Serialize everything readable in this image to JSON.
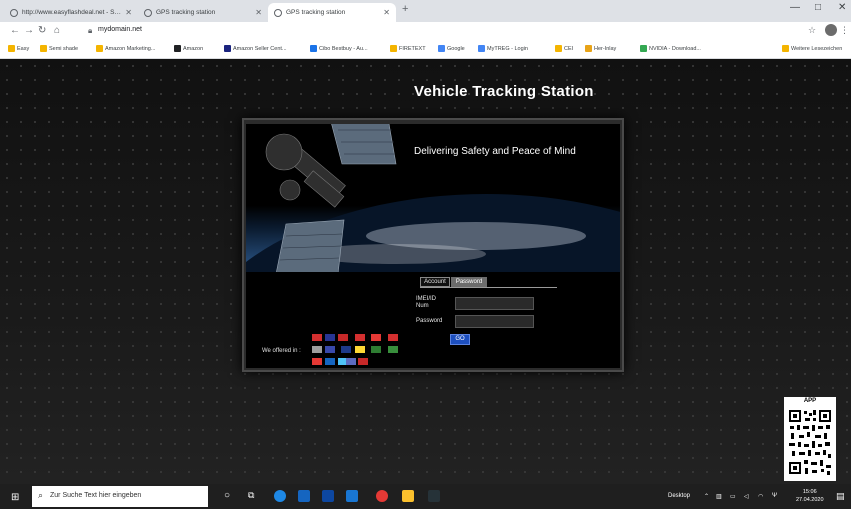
{
  "browser": {
    "tabs": [
      {
        "title": "http://www.easyflashdeal.net - Sicurp",
        "active": false
      },
      {
        "title": "GPS tracking station",
        "active": false
      },
      {
        "title": "GPS tracking station",
        "active": true
      }
    ],
    "url": "mydomain.net",
    "bookmarks": [
      "Easy",
      "Semi shade",
      "Amazon Marketing...",
      "Amazon",
      "Amazon Seller Cent...",
      "Cibo Bestbuy - Au...",
      "FIRETEXT",
      "Google",
      "MyTREG - Login",
      "CEI",
      "Her-Inlay",
      "NVIDIA - Download...",
      "Weitere Lesezeichen"
    ],
    "colors": {
      "bookmark_icons": [
        "#f4b400",
        "#f4b400",
        "#f4b400",
        "#202124",
        "#1a237e",
        "#1a73e8",
        "#f4b400",
        "#4285f4",
        "#4285f4",
        "#f4b400",
        "#e8a317",
        "#34a853",
        "#f4b400"
      ]
    }
  },
  "site": {
    "title": "Vehicle Tracking Station",
    "tagline": "Delivering Safety and Peace of Mind",
    "login": {
      "tab_account": "Account",
      "tab_password": "Password",
      "user_label_1": "IMEI/ID",
      "user_label_2": "Num",
      "password_label": "Password",
      "user_value": "",
      "password_value": "",
      "go_label": "GO"
    },
    "offered_in": "We offered in :",
    "flag_colors": [
      "#d32f2f",
      "#283593",
      "#c62828",
      "#d32f2f",
      "#e53935",
      "#d32f2f",
      "#9e9e9e",
      "#3949ab",
      "#1e3a8a",
      "#fdd835",
      "#2e7d32",
      "#388e3c",
      "#e53935",
      "#1565c0",
      "#4fc3f7",
      "#5c6bc0",
      "#c62828"
    ]
  },
  "qr": {
    "title": "APP"
  },
  "taskbar": {
    "search_placeholder": "Zur Suche Text hier eingeben",
    "tray_text": "Desktop",
    "time": "15:06",
    "date": "27.04.2020"
  }
}
